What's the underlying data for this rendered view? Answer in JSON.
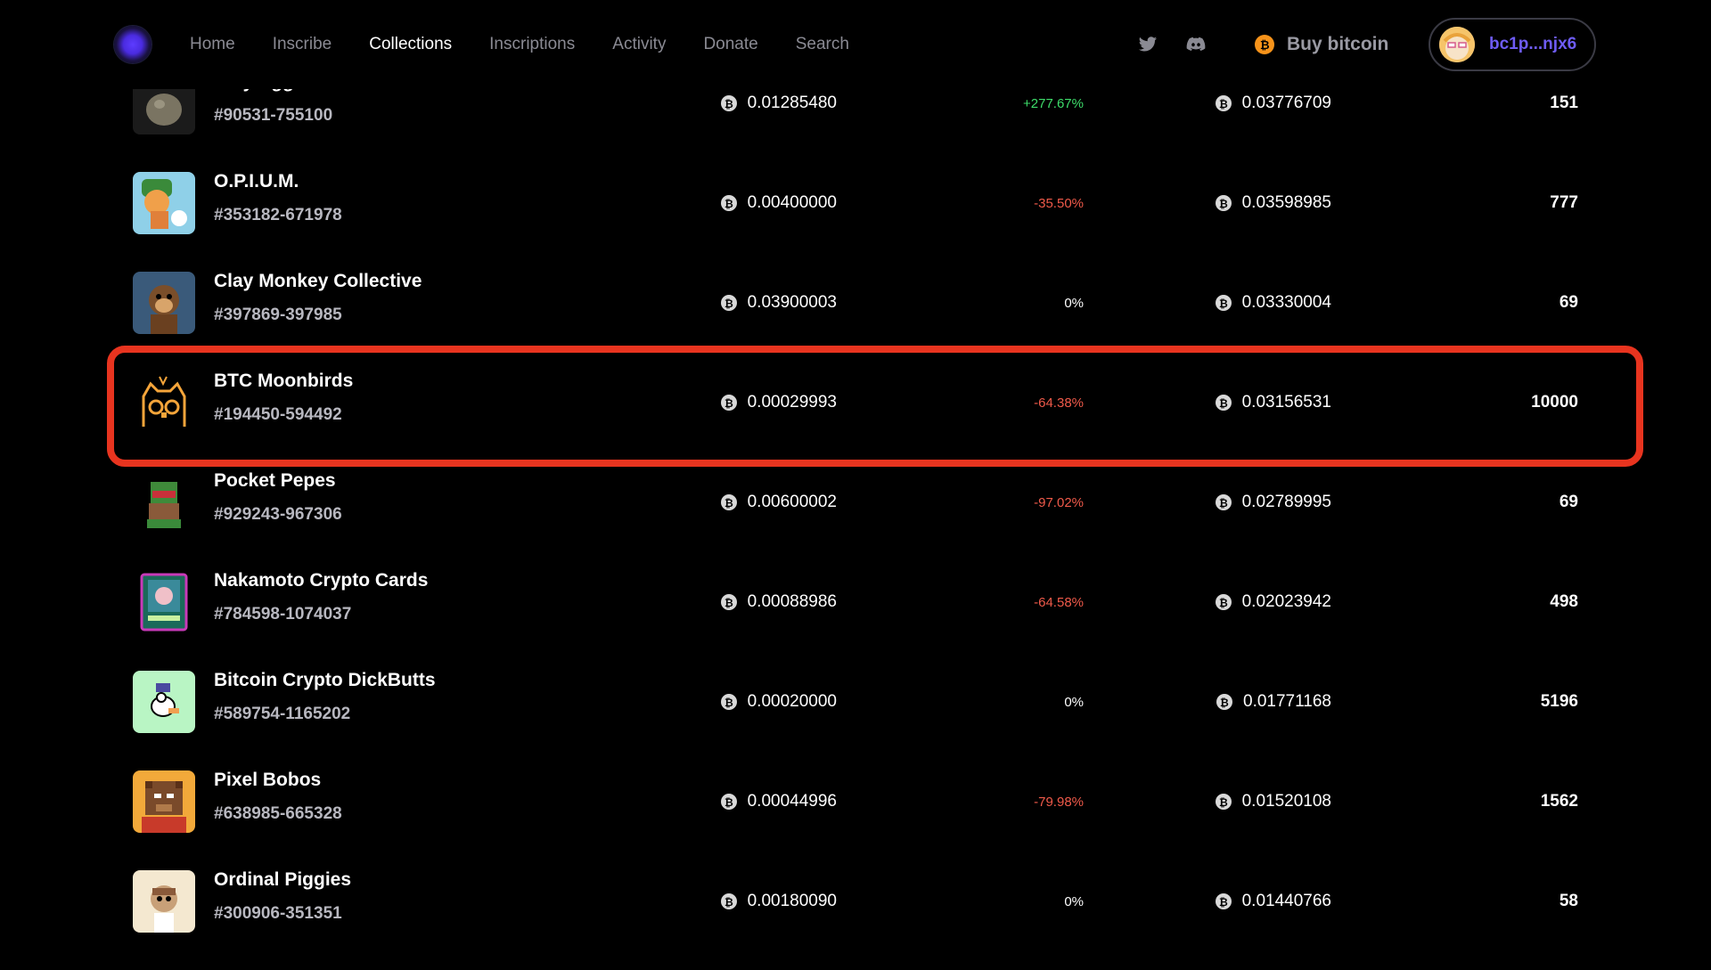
{
  "nav": {
    "items": [
      "Home",
      "Inscribe",
      "Collections",
      "Inscriptions",
      "Activity",
      "Donate",
      "Search"
    ],
    "active": "Collections"
  },
  "header": {
    "buy_label": "Buy bitcoin",
    "wallet_label": "bc1p...njx6",
    "social_icons": [
      "twitter-icon",
      "discord-icon"
    ]
  },
  "colors": {
    "accent": "#6e5cf5",
    "bitcoin": "#f7931a",
    "positive": "#3ddc6a",
    "negative": "#f05a4a",
    "highlight_border": "#e8341f"
  },
  "collections": [
    {
      "name": "Clay Eggs",
      "range": "#90531-755100",
      "price": "0.01285480",
      "change": "+277.67%",
      "change_dir": "pos",
      "volume": "0.03776709",
      "count": "151",
      "thumb": "egg"
    },
    {
      "name": "O.P.I.U.M.",
      "range": "#353182-671978",
      "price": "0.00400000",
      "change": "-35.50%",
      "change_dir": "neg",
      "volume": "0.03598985",
      "count": "777",
      "thumb": "opium"
    },
    {
      "name": "Clay Monkey Collective",
      "range": "#397869-397985",
      "price": "0.03900003",
      "change": "0%",
      "change_dir": "zero",
      "volume": "0.03330004",
      "count": "69",
      "thumb": "monkey"
    },
    {
      "name": "BTC Moonbirds",
      "range": "#194450-594492",
      "price": "0.00029993",
      "change": "-64.38%",
      "change_dir": "neg",
      "volume": "0.03156531",
      "count": "10000",
      "thumb": "moonbird",
      "highlighted": true
    },
    {
      "name": "Pocket Pepes",
      "range": "#929243-967306",
      "price": "0.00600002",
      "change": "-97.02%",
      "change_dir": "neg",
      "volume": "0.02789995",
      "count": "69",
      "thumb": "pepe"
    },
    {
      "name": "Nakamoto Crypto Cards",
      "range": "#784598-1074037",
      "price": "0.00088986",
      "change": "-64.58%",
      "change_dir": "neg",
      "volume": "0.02023942",
      "count": "498",
      "thumb": "card"
    },
    {
      "name": "Bitcoin Crypto DickButts",
      "range": "#589754-1165202",
      "price": "0.00020000",
      "change": "0%",
      "change_dir": "zero",
      "volume": "0.01771168",
      "count": "5196",
      "thumb": "dickbutt"
    },
    {
      "name": "Pixel Bobos",
      "range": "#638985-665328",
      "price": "0.00044996",
      "change": "-79.98%",
      "change_dir": "neg",
      "volume": "0.01520108",
      "count": "1562",
      "thumb": "bobo"
    },
    {
      "name": "Ordinal Piggies",
      "range": "#300906-351351",
      "price": "0.00180090",
      "change": "0%",
      "change_dir": "zero",
      "volume": "0.01440766",
      "count": "58",
      "thumb": "piggy"
    }
  ]
}
